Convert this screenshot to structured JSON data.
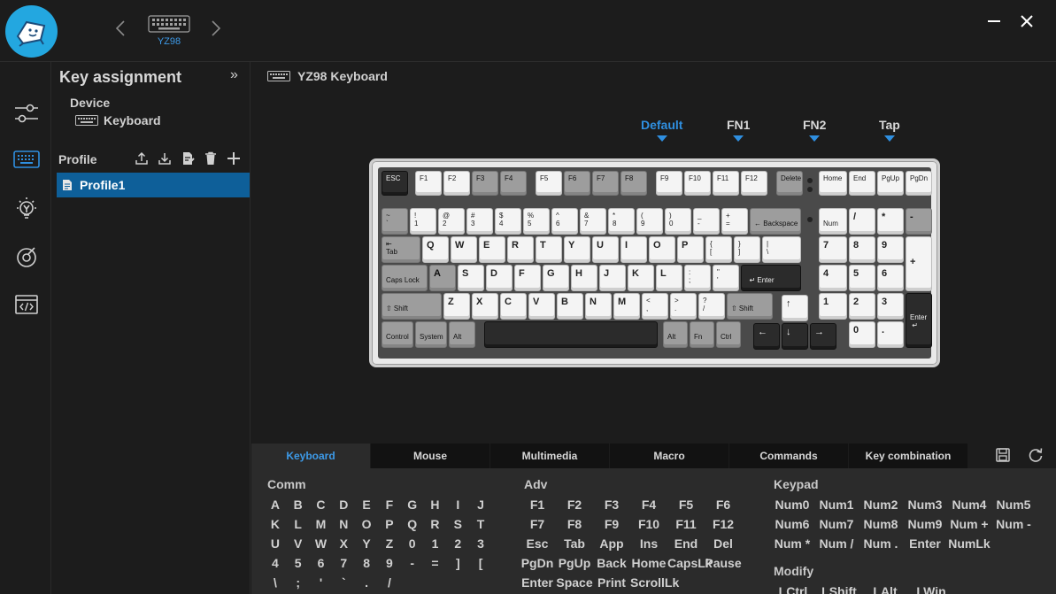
{
  "topbar": {
    "device_name": "YZ98",
    "minimize_icon": "minimize-icon",
    "close_icon": "close-icon",
    "prev_icon": "chevron-left-icon",
    "next_icon": "chevron-right-icon"
  },
  "panel": {
    "title": "Key assignment",
    "collapse": "»",
    "device_label": "Device",
    "device_value": "Keyboard",
    "profile_label": "Profile",
    "profiles": [
      "Profile1"
    ]
  },
  "main": {
    "title": "YZ98 Keyboard",
    "layers": [
      "Default",
      "FN1",
      "FN2",
      "Tap"
    ],
    "active_layer": "Default"
  },
  "tabs": [
    "Keyboard",
    "Mouse",
    "Multimedia",
    "Macro",
    "Commands",
    "Key combination"
  ],
  "groups": {
    "comm": {
      "title": "Comm",
      "keys": [
        "A",
        "B",
        "C",
        "D",
        "E",
        "F",
        "G",
        "H",
        "I",
        "J",
        "K",
        "L",
        "M",
        "N",
        "O",
        "P",
        "Q",
        "R",
        "S",
        "T",
        "U",
        "V",
        "W",
        "X",
        "Y",
        "Z",
        "0",
        "1",
        "2",
        "3",
        "4",
        "5",
        "6",
        "7",
        "8",
        "9",
        "-",
        "=",
        "]",
        "[",
        "\\",
        ";",
        "'",
        "`",
        ".",
        "/"
      ]
    },
    "adv": {
      "title": "Adv",
      "keys": [
        "F1",
        "F2",
        "F3",
        "F4",
        "F5",
        "F6",
        "F7",
        "F8",
        "F9",
        "F10",
        "F11",
        "F12",
        "Esc",
        "Tab",
        "App",
        "Ins",
        "End",
        "Del",
        "PgDn",
        "PgUp",
        "Back",
        "Home",
        "CapsLk",
        "Pause",
        "Enter",
        "Space",
        "Print",
        "ScrollLk"
      ]
    },
    "keypad": {
      "title": "Keypad",
      "keys": [
        "Num0",
        "Num1",
        "Num2",
        "Num3",
        "Num4",
        "Num5",
        "Num6",
        "Num7",
        "Num8",
        "Num9",
        "Num +",
        "Num -",
        "Num *",
        "Num /",
        "Num .",
        "Enter",
        "NumLk"
      ]
    },
    "modify": {
      "title": "Modify",
      "keys": [
        "LCtrl",
        "LShift",
        "LAlt",
        "LWin"
      ]
    }
  },
  "colors": {
    "accent": "#2f8fe0",
    "selection": "#0e5f99",
    "logo": "#23a7e0"
  }
}
